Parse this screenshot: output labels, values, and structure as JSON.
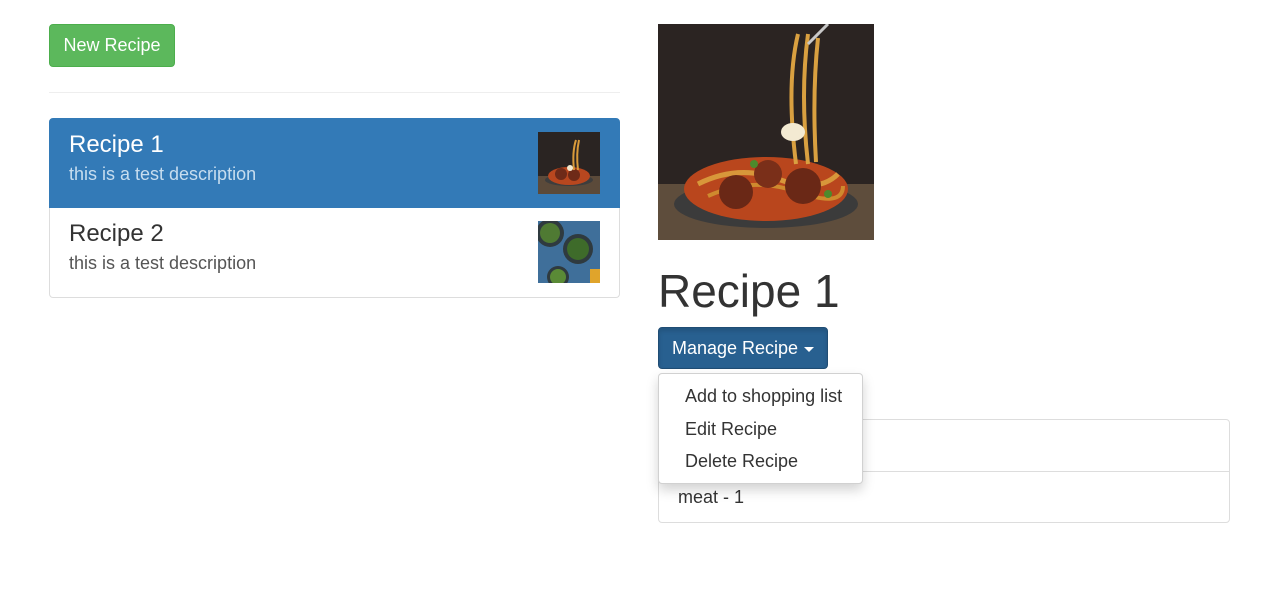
{
  "toolbar": {
    "new_recipe_label": "New Recipe"
  },
  "recipe_list": [
    {
      "title": "Recipe 1",
      "description": "this is a test description",
      "active": true,
      "image": "spaghetti-meatballs-image"
    },
    {
      "title": "Recipe 2",
      "description": "this is a test description",
      "active": false,
      "image": "greens-bowls-image"
    }
  ],
  "detail": {
    "title": "Recipe 1",
    "image": "spaghetti-meatballs-image",
    "manage_label": "Manage Recipe",
    "menu": [
      "Add to shopping list",
      "Edit Recipe",
      "Delete Recipe"
    ],
    "ingredients": [
      "",
      "meat - 1"
    ]
  },
  "colors": {
    "success": "#5cb85c",
    "primary": "#337ab7",
    "primary_dark": "#286090"
  }
}
